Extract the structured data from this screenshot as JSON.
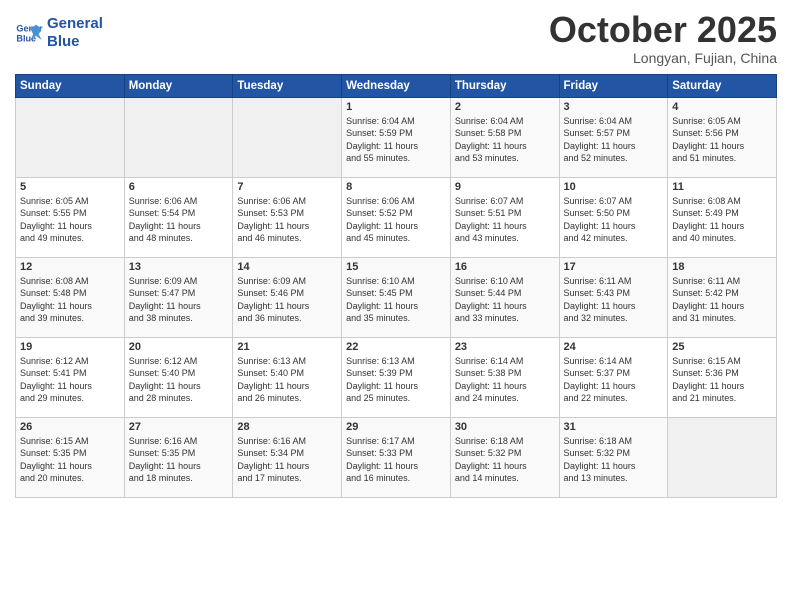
{
  "header": {
    "logo_line1": "General",
    "logo_line2": "Blue",
    "month": "October 2025",
    "location": "Longyan, Fujian, China"
  },
  "days_of_week": [
    "Sunday",
    "Monday",
    "Tuesday",
    "Wednesday",
    "Thursday",
    "Friday",
    "Saturday"
  ],
  "weeks": [
    [
      {
        "day": "",
        "info": ""
      },
      {
        "day": "",
        "info": ""
      },
      {
        "day": "",
        "info": ""
      },
      {
        "day": "1",
        "info": "Sunrise: 6:04 AM\nSunset: 5:59 PM\nDaylight: 11 hours\nand 55 minutes."
      },
      {
        "day": "2",
        "info": "Sunrise: 6:04 AM\nSunset: 5:58 PM\nDaylight: 11 hours\nand 53 minutes."
      },
      {
        "day": "3",
        "info": "Sunrise: 6:04 AM\nSunset: 5:57 PM\nDaylight: 11 hours\nand 52 minutes."
      },
      {
        "day": "4",
        "info": "Sunrise: 6:05 AM\nSunset: 5:56 PM\nDaylight: 11 hours\nand 51 minutes."
      }
    ],
    [
      {
        "day": "5",
        "info": "Sunrise: 6:05 AM\nSunset: 5:55 PM\nDaylight: 11 hours\nand 49 minutes."
      },
      {
        "day": "6",
        "info": "Sunrise: 6:06 AM\nSunset: 5:54 PM\nDaylight: 11 hours\nand 48 minutes."
      },
      {
        "day": "7",
        "info": "Sunrise: 6:06 AM\nSunset: 5:53 PM\nDaylight: 11 hours\nand 46 minutes."
      },
      {
        "day": "8",
        "info": "Sunrise: 6:06 AM\nSunset: 5:52 PM\nDaylight: 11 hours\nand 45 minutes."
      },
      {
        "day": "9",
        "info": "Sunrise: 6:07 AM\nSunset: 5:51 PM\nDaylight: 11 hours\nand 43 minutes."
      },
      {
        "day": "10",
        "info": "Sunrise: 6:07 AM\nSunset: 5:50 PM\nDaylight: 11 hours\nand 42 minutes."
      },
      {
        "day": "11",
        "info": "Sunrise: 6:08 AM\nSunset: 5:49 PM\nDaylight: 11 hours\nand 40 minutes."
      }
    ],
    [
      {
        "day": "12",
        "info": "Sunrise: 6:08 AM\nSunset: 5:48 PM\nDaylight: 11 hours\nand 39 minutes."
      },
      {
        "day": "13",
        "info": "Sunrise: 6:09 AM\nSunset: 5:47 PM\nDaylight: 11 hours\nand 38 minutes."
      },
      {
        "day": "14",
        "info": "Sunrise: 6:09 AM\nSunset: 5:46 PM\nDaylight: 11 hours\nand 36 minutes."
      },
      {
        "day": "15",
        "info": "Sunrise: 6:10 AM\nSunset: 5:45 PM\nDaylight: 11 hours\nand 35 minutes."
      },
      {
        "day": "16",
        "info": "Sunrise: 6:10 AM\nSunset: 5:44 PM\nDaylight: 11 hours\nand 33 minutes."
      },
      {
        "day": "17",
        "info": "Sunrise: 6:11 AM\nSunset: 5:43 PM\nDaylight: 11 hours\nand 32 minutes."
      },
      {
        "day": "18",
        "info": "Sunrise: 6:11 AM\nSunset: 5:42 PM\nDaylight: 11 hours\nand 31 minutes."
      }
    ],
    [
      {
        "day": "19",
        "info": "Sunrise: 6:12 AM\nSunset: 5:41 PM\nDaylight: 11 hours\nand 29 minutes."
      },
      {
        "day": "20",
        "info": "Sunrise: 6:12 AM\nSunset: 5:40 PM\nDaylight: 11 hours\nand 28 minutes."
      },
      {
        "day": "21",
        "info": "Sunrise: 6:13 AM\nSunset: 5:40 PM\nDaylight: 11 hours\nand 26 minutes."
      },
      {
        "day": "22",
        "info": "Sunrise: 6:13 AM\nSunset: 5:39 PM\nDaylight: 11 hours\nand 25 minutes."
      },
      {
        "day": "23",
        "info": "Sunrise: 6:14 AM\nSunset: 5:38 PM\nDaylight: 11 hours\nand 24 minutes."
      },
      {
        "day": "24",
        "info": "Sunrise: 6:14 AM\nSunset: 5:37 PM\nDaylight: 11 hours\nand 22 minutes."
      },
      {
        "day": "25",
        "info": "Sunrise: 6:15 AM\nSunset: 5:36 PM\nDaylight: 11 hours\nand 21 minutes."
      }
    ],
    [
      {
        "day": "26",
        "info": "Sunrise: 6:15 AM\nSunset: 5:35 PM\nDaylight: 11 hours\nand 20 minutes."
      },
      {
        "day": "27",
        "info": "Sunrise: 6:16 AM\nSunset: 5:35 PM\nDaylight: 11 hours\nand 18 minutes."
      },
      {
        "day": "28",
        "info": "Sunrise: 6:16 AM\nSunset: 5:34 PM\nDaylight: 11 hours\nand 17 minutes."
      },
      {
        "day": "29",
        "info": "Sunrise: 6:17 AM\nSunset: 5:33 PM\nDaylight: 11 hours\nand 16 minutes."
      },
      {
        "day": "30",
        "info": "Sunrise: 6:18 AM\nSunset: 5:32 PM\nDaylight: 11 hours\nand 14 minutes."
      },
      {
        "day": "31",
        "info": "Sunrise: 6:18 AM\nSunset: 5:32 PM\nDaylight: 11 hours\nand 13 minutes."
      },
      {
        "day": "",
        "info": ""
      }
    ]
  ]
}
